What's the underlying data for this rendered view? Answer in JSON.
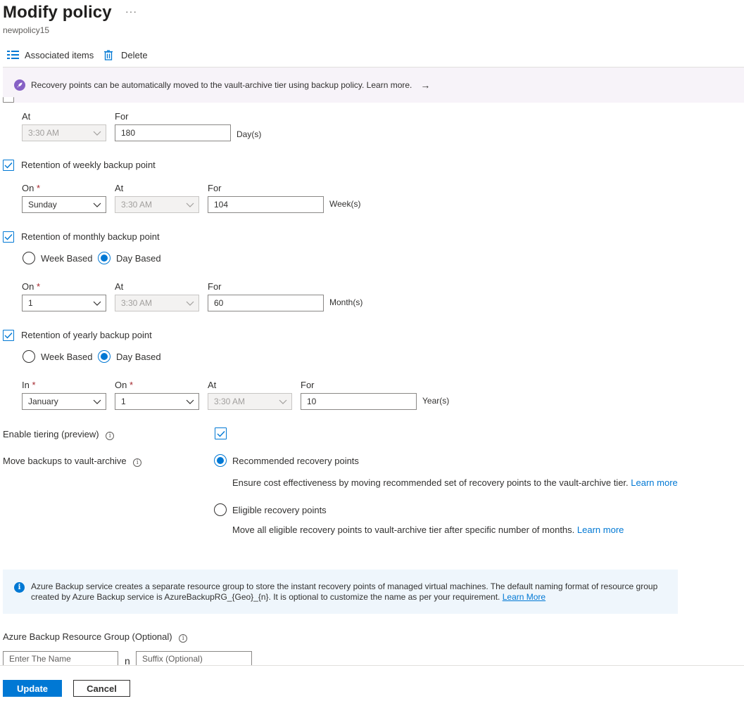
{
  "header": {
    "title": "Modify policy",
    "ellipsis": "···",
    "subtitle": "newpolicy15"
  },
  "toolbar": {
    "associated_items_label": "Associated items",
    "delete_label": "Delete"
  },
  "banner": {
    "text": "Recovery points can be automatically moved to the vault-archive tier using backup policy. Learn more.",
    "arrow": "→"
  },
  "daily": {
    "at_label": "At",
    "for_label": "For",
    "time_value": "3:30 AM",
    "for_value": "180",
    "unit": "Day(s)"
  },
  "weekly": {
    "checkbox_label": "Retention of weekly backup point",
    "checked": true,
    "on_label": "On",
    "required_mark": "*",
    "at_label": "At",
    "for_label": "For",
    "on_value": "Sunday",
    "time_value": "3:30 AM",
    "for_value": "104",
    "unit": "Week(s)"
  },
  "monthly": {
    "checkbox_label": "Retention of monthly backup point",
    "checked": true,
    "week_based_label": "Week Based",
    "day_based_label": "Day Based",
    "selected": "Day Based",
    "on_label": "On",
    "required_mark": "*",
    "at_label": "At",
    "for_label": "For",
    "on_value": "1",
    "time_value": "3:30 AM",
    "for_value": "60",
    "unit": "Month(s)"
  },
  "yearly": {
    "checkbox_label": "Retention of yearly backup point",
    "checked": true,
    "week_based_label": "Week Based",
    "day_based_label": "Day Based",
    "selected": "Day Based",
    "in_label": "In",
    "on_label": "On",
    "required_mark": "*",
    "at_label": "At",
    "for_label": "For",
    "in_value": "January",
    "on_value": "1",
    "time_value": "3:30 AM",
    "for_value": "10",
    "unit": "Year(s)"
  },
  "tiering": {
    "enable_label": "Enable tiering (preview)",
    "enabled": true,
    "move_label": "Move backups to vault-archive",
    "selected": "Recommended recovery points",
    "recommended_label": "Recommended recovery points",
    "recommended_desc": "Ensure cost effectiveness by moving recommended set of recovery points to the vault-archive tier.",
    "eligible_label": "Eligible recovery points",
    "eligible_desc": "Move all eligible recovery points to vault-archive tier after specific number of months.",
    "learn_more": "Learn more"
  },
  "info": {
    "text_line1": "Azure Backup service creates a separate resource group to store the instant recovery points of managed virtual machines. The default naming format of resource group",
    "text_line2": "created by Azure Backup service is AzureBackupRG_{Geo}_{n}. It is optional to customize the name as per your requirement.",
    "learn_more": "Learn More"
  },
  "resource_group": {
    "label": "Azure Backup Resource Group (Optional)",
    "name_placeholder": "Enter The Name",
    "separator": "n",
    "suffix_placeholder": "Suffix (Optional)"
  },
  "footer": {
    "update_label": "Update",
    "cancel_label": "Cancel"
  },
  "colors": {
    "accent": "#0078d4",
    "banner_bg": "#f7f3f9",
    "info_bg": "#eff6fc",
    "required": "#a4262c"
  }
}
